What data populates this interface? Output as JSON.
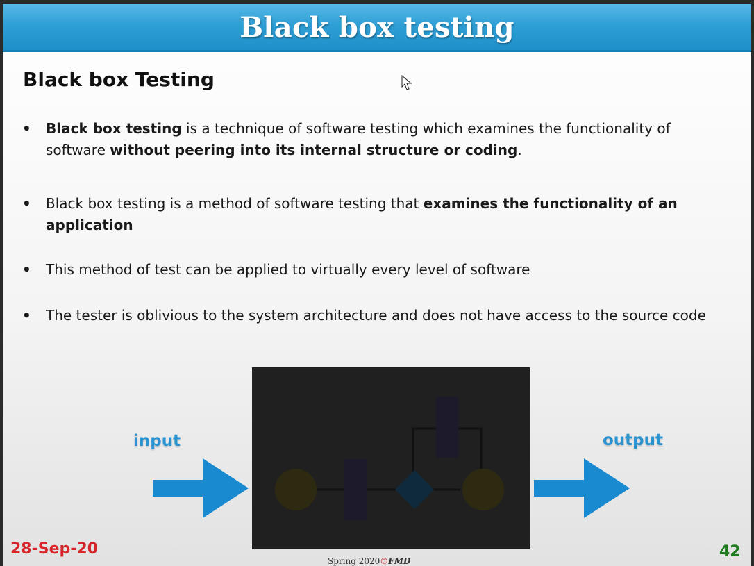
{
  "slide": {
    "title": "Black box testing",
    "heading": "Black box Testing",
    "bullets": [
      {
        "parts": [
          {
            "text": "Black box testing",
            "bold": true
          },
          {
            "text": " is a technique of software testing which examines the functionality of software ",
            "bold": false
          },
          {
            "text": "without peering into its internal structure or coding",
            "bold": true
          },
          {
            "text": ".",
            "bold": false
          }
        ]
      },
      {
        "parts": [
          {
            "text": "Black box testing is a method of software testing that ",
            "bold": false
          },
          {
            "text": "examines the functionality of an application",
            "bold": true
          }
        ]
      },
      {
        "parts": [
          {
            "text": "This method of test can be applied to virtually every level of software",
            "bold": false
          }
        ]
      },
      {
        "parts": [
          {
            "text": "The tester is oblivious to the system architecture and does not have access to the source code",
            "bold": false
          }
        ]
      }
    ],
    "bullet_symbol": "•",
    "diagram": {
      "input_label": "input",
      "output_label": "output",
      "arrow_color": "#1a8ad0",
      "box_color": "#202020"
    },
    "footer": {
      "date": "28-Sep-20",
      "center_prefix": "Spring  2020",
      "center_symbol": "©",
      "center_author": "FMD",
      "page_number": "42"
    }
  },
  "colors": {
    "title_bar": "#2f9fd6",
    "date_red": "#d7262b",
    "page_green": "#1d7a1d"
  }
}
